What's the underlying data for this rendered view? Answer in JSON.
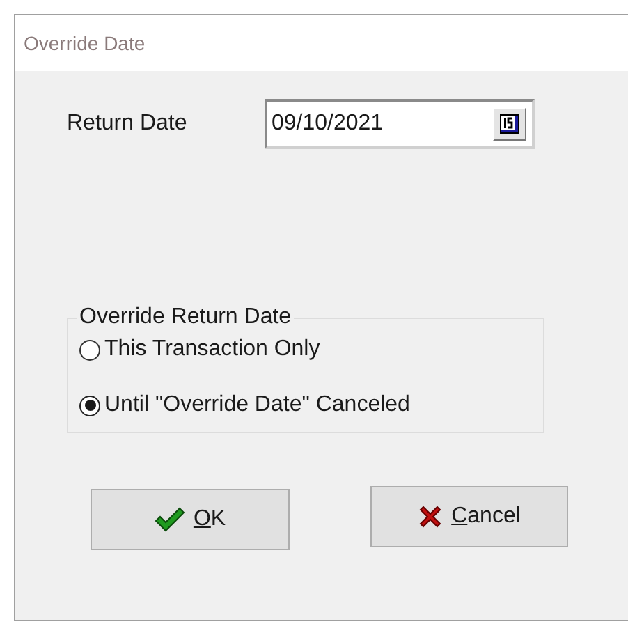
{
  "window": {
    "title": "Override Date"
  },
  "return_date": {
    "label": "Return Date",
    "value": "09/10/2021"
  },
  "override_group": {
    "legend": "Override Return Date",
    "options": [
      {
        "label": "This Transaction Only",
        "selected": false
      },
      {
        "label": "Until \"Override Date\" Canceled",
        "selected": true
      }
    ]
  },
  "buttons": [
    {
      "kind": "ok",
      "mnemonic": "O",
      "label_rest": "K"
    },
    {
      "kind": "cancel",
      "mnemonic": "C",
      "label_rest": "ancel"
    }
  ]
}
